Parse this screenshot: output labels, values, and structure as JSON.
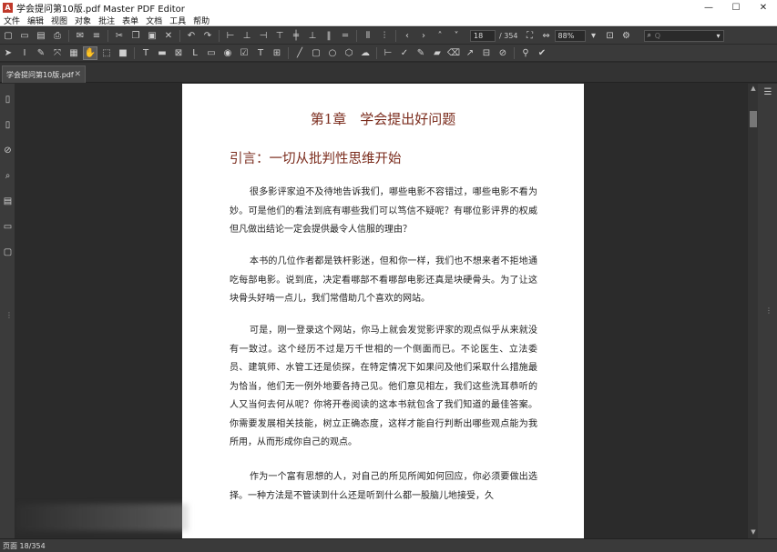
{
  "window": {
    "title": "学会提问第10版.pdf Master PDF Editor",
    "app_icon": "pdf-app-icon",
    "minimize": "—",
    "maximize": "☐",
    "close": "✕"
  },
  "menu": [
    "文件",
    "编辑",
    "视图",
    "对象",
    "批注",
    "表单",
    "文档",
    "工具",
    "帮助"
  ],
  "toolbar": {
    "page_current": "18",
    "page_total": "/ 354",
    "zoom": "88%",
    "search_placeholder": "Q"
  },
  "tab": {
    "label": "学会提问第10版.pdf",
    "close": "✕"
  },
  "document": {
    "chapter": "第1章　学会提出好问题",
    "heading": "引言：一切从批判性思维开始",
    "paragraphs": [
      "很多影评家迫不及待地告诉我们，哪些电影不容错过，哪些电影不看为妙。可是他们的看法到底有哪些我们可以笃信不疑呢？有哪位影评界的权威但凡做出结论一定会提供最令人信服的理由？",
      "本书的几位作者都是铁杆影迷，但和你一样，我们也不想来者不拒地通吃每部电影。说到底，决定看哪部不看哪部电影还真是块硬骨头。为了让这块骨头好啃一点儿，我们常借助几个喜欢的网站。",
      "可是，刚一登录这个网站，你马上就会发觉影评家的观点似乎从来就没有一致过。这个经历不过是万千世相的一个侧面而已。不论医生、立法委员、建筑师、水管工还是侦探，在特定情况下如果问及他们采取什么措施最为恰当，他们无一例外地要各持己见。他们意见相左，我们这些洗耳恭听的人又当何去何从呢？你将开卷阅读的这本书就包含了我们知道的最佳答案。你需要发展相关技能，树立正确态度，这样才能自行判断出哪些观点能为我所用，从而形成你自己的观点。",
      "作为一个富有思想的人，对自己的所见所闻如何回应，你必须要做出选择。一种方法是不管读到什么还是听到什么都一股脑儿地接受，久"
    ]
  },
  "status": {
    "page_info": "页面 18/354"
  }
}
